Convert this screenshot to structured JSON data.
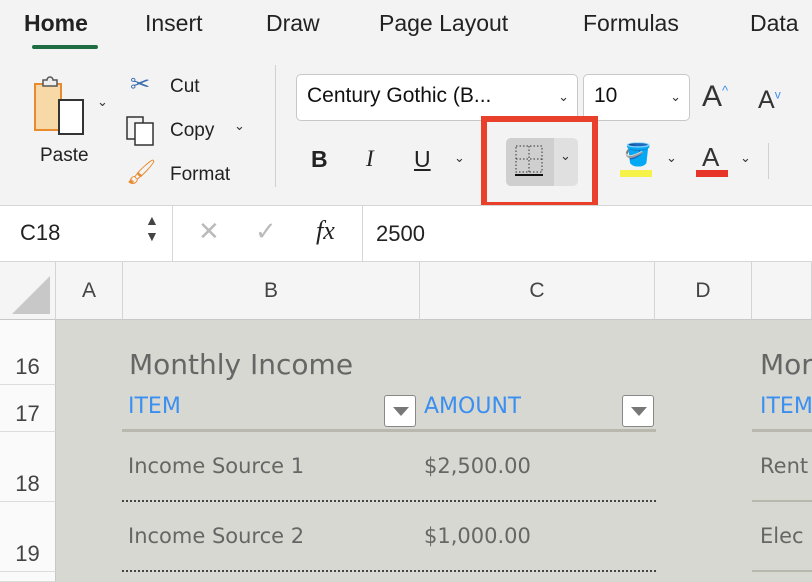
{
  "tabs": [
    {
      "label": "Home",
      "active": true
    },
    {
      "label": "Insert"
    },
    {
      "label": "Draw"
    },
    {
      "label": "Page Layout"
    },
    {
      "label": "Formulas"
    },
    {
      "label": "Data"
    }
  ],
  "clipboard": {
    "paste": "Paste",
    "cut": "Cut",
    "copy": "Copy",
    "format": "Format"
  },
  "font": {
    "name": "Century Gothic (B...",
    "size": "10"
  },
  "format_buttons": {
    "bold": "B",
    "italic": "I",
    "underline": "U",
    "font_color_letter": "A"
  },
  "colors": {
    "highlight": "#f5f34a",
    "font_color": "#e8352a",
    "accent_tab": "#1f6e43",
    "highlight_box": "#e8402a",
    "header_text": "#3b8ff0"
  },
  "formula_bar": {
    "name_box": "C18",
    "fx": "fx",
    "value": "2500"
  },
  "columns": [
    "A",
    "B",
    "C",
    "D"
  ],
  "rows": [
    "16",
    "17",
    "18",
    "19"
  ],
  "table": {
    "title": "Monthly Income",
    "headers": [
      "ITEM",
      "AMOUNT"
    ],
    "rows": [
      [
        "Income Source 1",
        "$2,500.00"
      ],
      [
        "Income Source 2",
        "$1,000.00"
      ]
    ]
  },
  "table2": {
    "title_partial": "Mor",
    "header_partial": "ITEM",
    "rows_partial": [
      "Rent",
      "Elec"
    ]
  }
}
